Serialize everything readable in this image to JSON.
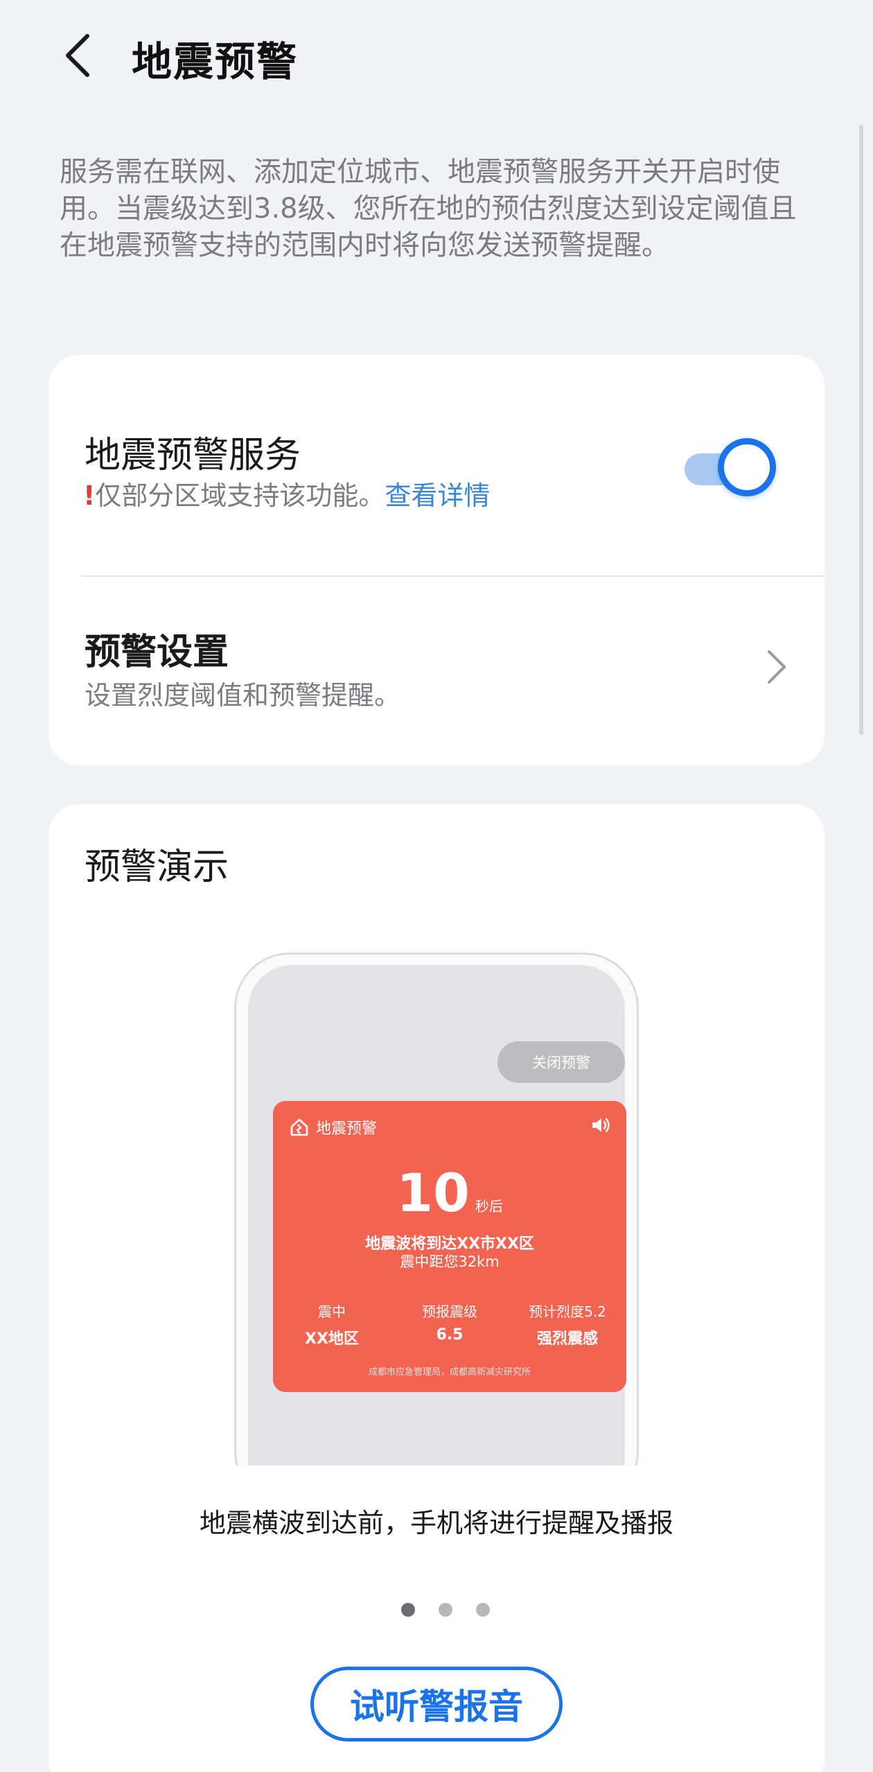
{
  "header": {
    "title": "地震预警"
  },
  "description": "服务需在联网、添加定位城市、地震预警服务开关开启时使用。当震级达到3.8级、您所在地的预估烈度达到设定阈值且在地震预警支持的范围内时将向您发送预警提醒。",
  "service": {
    "title": "地震预警服务",
    "warn_mark": "!",
    "subtitle": "仅部分区域支持该功能。",
    "link": "查看详情",
    "enabled": true
  },
  "settings": {
    "title": "预警设置",
    "subtitle": "设置烈度阈值和预警提醒。"
  },
  "demo": {
    "title": "预警演示",
    "close_label": "关闭预警",
    "alert_title": "地震预警",
    "countdown": "10",
    "countdown_unit": "秒后",
    "arrive_text": "地震波将到达XX市XX区",
    "distance_text": "震中距您32km",
    "stats": [
      {
        "label": "震中",
        "value": "XX地区"
      },
      {
        "label": "预报震级",
        "value": "6.5"
      },
      {
        "label": "预计烈度5.2",
        "value": "强烈震感"
      }
    ],
    "footer": "成都市应急管理局，成都高新减灾研究所",
    "caption": "地震横波到达前，手机将进行提醒及播报",
    "pages": 3,
    "active_page": 1,
    "button_label": "试听警报音"
  },
  "colors": {
    "accent": "#1a73e8",
    "alert": "#f26352",
    "background": "#f1f2f6"
  }
}
